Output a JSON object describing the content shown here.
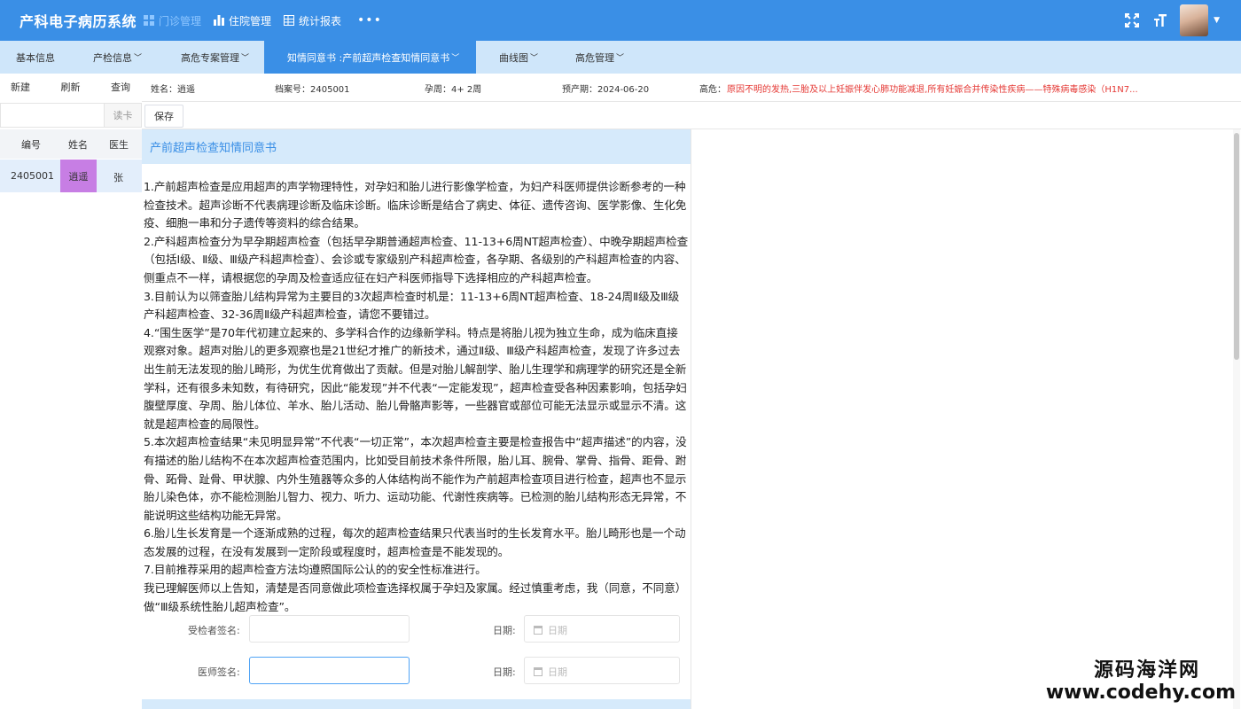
{
  "app": {
    "title": "产科电子病历系统"
  },
  "topnav": [
    {
      "label": "门诊管理",
      "icon": "grid-icon",
      "active": true
    },
    {
      "label": "住院管理",
      "icon": "bar-chart-icon",
      "active": false
    },
    {
      "label": "统计报表",
      "icon": "table-icon",
      "active": false
    }
  ],
  "more": "•••",
  "tabs": [
    {
      "label": "基本信息"
    },
    {
      "label": "产检信息"
    },
    {
      "label": "高危专案管理"
    },
    {
      "label": "知情同意书 :产前超声检查知情同意书"
    },
    {
      "label": "曲线图"
    },
    {
      "label": "高危管理"
    }
  ],
  "actions": {
    "new": "新建",
    "refresh": "刷新",
    "query": "查询"
  },
  "patient": {
    "name": "姓名：逍遥",
    "file_no": "档案号：2405001",
    "gestation": "孕周：4+ 2周",
    "due": "预产期：2024-06-20",
    "risk_label": "高危：",
    "risk_text": "原因不明的发热,三胎及以上妊娠伴发心肺功能减退,所有妊娠合并传染性疾病——特殊病毒感染（H1N7..."
  },
  "search": {
    "placeholder": "",
    "read_card": "读卡"
  },
  "toolbar": {
    "save": "保存"
  },
  "grid": {
    "headers": [
      "编号",
      "姓名",
      "医生"
    ],
    "rows": [
      {
        "id": "2405001",
        "name": "逍遥",
        "doctor": "张"
      }
    ]
  },
  "doc": {
    "title": "产前超声检查知情同意书",
    "paragraphs": [
      "1.产前超声检查是应用超声的声学物理特性，对孕妇和胎儿进行影像学检查，为妇产科医师提供诊断参考的一种检查技术。超声诊断不代表病理诊断及临床诊断。临床诊断是结合了病史、体征、遗传咨询、医学影像、生化免疫、细胞一串和分子遗传等资料的综合结果。",
      "2.产科超声检查分为早孕期超声检查（包括早孕期普通超声检查、11-13+6周NT超声检查）、中晚孕期超声检查（包括Ⅰ级、Ⅱ级、Ⅲ级产科超声检查）、会诊或专家级别产科超声检查，各孕期、各级别的产科超声检查的内容、侧重点不一样，请根据您的孕周及检查适应征在妇产科医师指导下选择相应的产科超声检查。",
      "3.目前认为以筛查胎儿结构异常为主要目的3次超声检查时机是：11-13+6周NT超声检查、18-24周Ⅱ级及Ⅲ级产科超声检查、32-36周Ⅱ级产科超声检查，请您不要错过。",
      "4.“围生医学”是70年代初建立起来的、多学科合作的边缘新学科。特点是将胎儿视为独立生命，成为临床直接观察对象。超声对胎儿的更多观察也是21世纪才推广的新技术，通过Ⅱ级、Ⅲ级产科超声检查，发现了许多过去出生前无法发现的胎儿畸形，为优生优育做出了贡献。但是对胎儿解剖学、胎儿生理学和病理学的研究还是全新学科，还有很多未知数，有待研究，因此“能发现”并不代表“一定能发现”，超声检查受各种因素影响，包括孕妇腹壁厚度、孕周、胎儿体位、羊水、胎儿活动、胎儿骨骼声影等，一些器官或部位可能无法显示或显示不清。这就是超声检查的局限性。",
      "5.本次超声检查结果“未见明显异常”不代表“一切正常”，本次超声检查主要是检查报告中“超声描述”的内容，没有描述的胎儿结构不在本次超声检查范围内，比如受目前技术条件所限，胎儿耳、腕骨、掌骨、指骨、距骨、跗骨、跖骨、趾骨、甲状腺、内外生殖器等众多的人体结构尚不能作为产前超声检查项目进行检查，超声也不显示胎儿染色体，亦不能检测胎儿智力、视力、听力、运动功能、代谢性疾病等。已检测的胎儿结构形态无异常，不能说明这些结构功能无异常。",
      "6.胎儿生长发育是一个逐渐成熟的过程，每次的超声检查结果只代表当时的生长发育水平。胎儿畸形也是一个动态发展的过程，在没有发展到一定阶段或程度时，超声检查是不能发现的。",
      "7.目前推荐采用的超声检查方法均遵照国际公认的的安全性标准进行。",
      "我已理解医师以上告知，清楚是否同意做此项检查选择权属于孕妇及家属。经过慎重考虑，我（同意，不同意）做“Ⅲ级系统性胎儿超声检查”。"
    ],
    "patient_sign_label": "受检者签名:",
    "doctor_sign_label": "医师签名:",
    "date_label": "日期:",
    "date_placeholder": "日期"
  },
  "watermark": {
    "cn": "源码海洋网",
    "en": "www.codehy.com"
  },
  "colors": {
    "primary": "#3a8fe6",
    "tab_bg": "#cfe6fa",
    "highlight": "#c77ee4",
    "risk": "#e53935"
  }
}
